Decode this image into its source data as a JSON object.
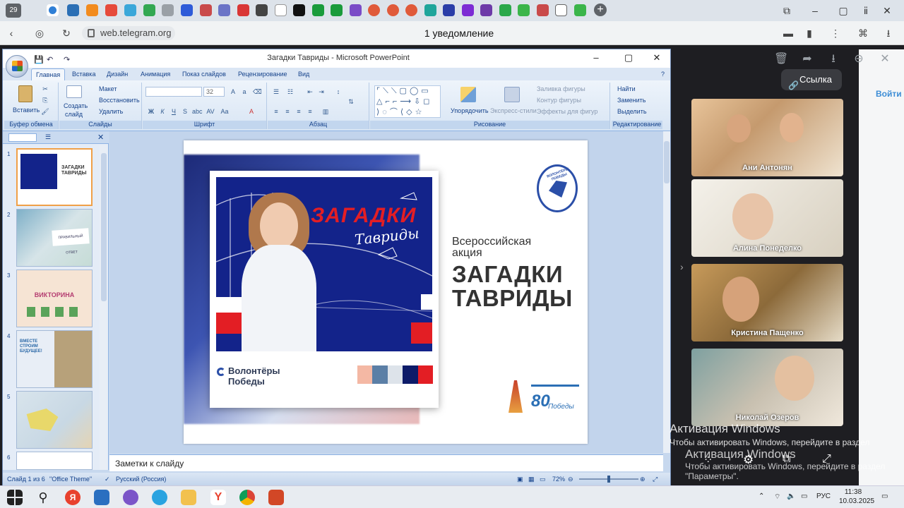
{
  "browser": {
    "tab_count": "29",
    "url": "web.telegram.org",
    "page_title": "1 уведомление"
  },
  "telegram": {
    "link_button": "Ссылка",
    "join_button": "Войти",
    "participants": [
      {
        "name": "Ани Антонян"
      },
      {
        "name": "Алина Понеделко"
      },
      {
        "name": "Кристина Пащенко"
      },
      {
        "name": "Николай Озеров"
      }
    ]
  },
  "powerpoint": {
    "window_title": "Загадки Тавриды - Microsoft PowerPoint",
    "tabs": [
      "Главная",
      "Вставка",
      "Дизайн",
      "Анимация",
      "Показ слайдов",
      "Рецензирование",
      "Вид"
    ],
    "ribbon": {
      "clipboard": {
        "label": "Буфер обмена",
        "paste": "Вставить"
      },
      "slides": {
        "label": "Слайды",
        "create": "Создать",
        "create2": "слайд",
        "layout": "Макет",
        "reset": "Восстановить",
        "delete": "Удалить"
      },
      "font": {
        "label": "Шрифт",
        "size": "32"
      },
      "paragraph": {
        "label": "Абзац"
      },
      "drawing": {
        "label": "Рисование",
        "arrange": "Упорядочить",
        "quick_styles": "Экспресс-стили",
        "fill": "Заливка фигуры",
        "outline": "Контур фигуры",
        "effects": "Эффекты для фигур"
      },
      "editing": {
        "label": "Редактирование",
        "find": "Найти",
        "replace": "Заменить",
        "select": "Выделить"
      }
    },
    "thumbnails": [
      {
        "num": "1"
      },
      {
        "num": "2",
        "caption": "ПРАВИЛЬНЫЙ ОТВЕТ"
      },
      {
        "num": "3",
        "caption": "ВИКТОРИНА"
      },
      {
        "num": "4",
        "caption": "ВМЕСТЕ СТРОИМ БУДУЩЕЕ!"
      },
      {
        "num": "5"
      },
      {
        "num": "6"
      }
    ],
    "slide": {
      "banner_title": "ЗАГАДКИ",
      "banner_subtitle": "Тавриды",
      "subtitle_line1": "Всероссийская",
      "subtitle_line2": "акция",
      "title_line1": "ЗАГАДКИ",
      "title_line2": "ТАВРИДЫ",
      "volunteers_line1": "Волонтёры",
      "volunteers_line2": "Победы",
      "badge_80": "80",
      "badge_pobedy": "Победы",
      "logo_text": "ВОЛОНТЁРЫ ПОБЕДЫ",
      "palette": [
        "#f4b8a4",
        "#5b7fa6",
        "#dde3ea",
        "#0d1b69",
        "#e31e24"
      ]
    },
    "notes_placeholder": "Заметки к слайду",
    "status": {
      "slide_info": "Слайд 1 из 6",
      "theme": "\"Office Theme\"",
      "language": "Русский (Россия)",
      "zoom": "72%"
    }
  },
  "windows": {
    "activation_title": "Активация Windows",
    "activation_text": "Чтобы активировать Windows, перейдите в раздел",
    "activation_param": "\"Параметры\".",
    "tray_lang": "РУС",
    "time": "11:38",
    "date": "10.03.2025"
  }
}
